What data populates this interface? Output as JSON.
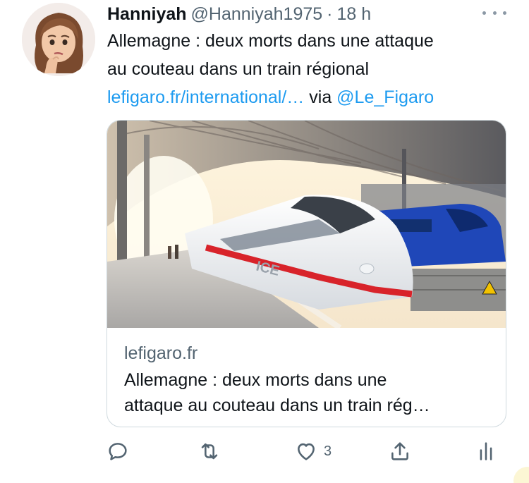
{
  "tweet": {
    "display_name": "Hanniyah",
    "handle": "@Hanniyah1975",
    "separator": "·",
    "time": "18 h",
    "text_line1": "Allemagne : deux morts dans une attaque",
    "text_line2": "au couteau dans un train régional",
    "link_url_text": "lefigaro.fr/international/…",
    "via_text": " via ",
    "via_mention": "@Le_Figaro"
  },
  "card": {
    "domain": "lefigaro.fr",
    "title_line1": "Allemagne : deux morts dans une",
    "title_line2": "attaque au couteau dans un train rég…",
    "image_text": "ICE"
  },
  "actions": {
    "reply_icon": "reply-icon",
    "retweet_icon": "retweet-icon",
    "like_icon": "heart-icon",
    "like_count": "3",
    "share_icon": "share-icon",
    "analytics_icon": "analytics-icon"
  },
  "colors": {
    "link": "#1d9bf0",
    "secondary_text": "#536471",
    "icon": "#536471",
    "card_border": "#cfd9de"
  }
}
